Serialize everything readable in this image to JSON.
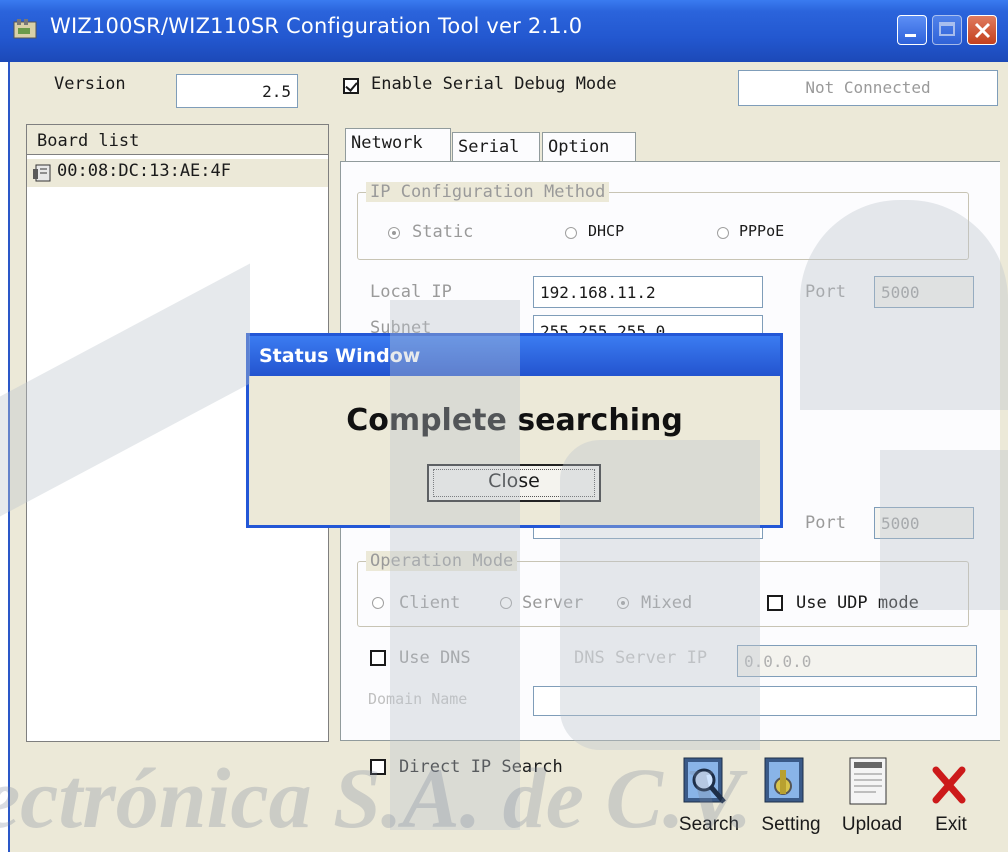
{
  "window": {
    "title": "WIZ100SR/WIZ110SR Configuration Tool ver 2.1.0"
  },
  "colors": {
    "titlebar": "#2358d0",
    "face": "#ece9d8",
    "status_border": "#2357d6"
  },
  "header": {
    "version_label": "Version",
    "version_value": "2.5",
    "debug_label": "Enable Serial Debug Mode",
    "debug_checked": true,
    "connection_status": "Not Connected"
  },
  "board_list": {
    "header": "Board list",
    "items": [
      {
        "label": "00:08:DC:13:AE:4F",
        "icon": "board-icon"
      }
    ]
  },
  "tabs": [
    {
      "label": "Network"
    },
    {
      "label": "Serial"
    },
    {
      "label": "Option"
    }
  ],
  "network": {
    "ip_method": {
      "title": "IP Configuration Method",
      "options": [
        {
          "label": "Static",
          "selected": true
        },
        {
          "label": "DHCP"
        },
        {
          "label": "PPPoE"
        }
      ]
    },
    "local_ip": {
      "label": "Local IP",
      "value": "192.168.11.2"
    },
    "port": {
      "label": "Port",
      "value": "5000"
    },
    "subnet": {
      "label": "Subnet",
      "value": "255.255.255.0"
    },
    "server_port": {
      "label": "Port",
      "value": "5000"
    },
    "operation_mode": {
      "title": "Operation Mode",
      "options": [
        {
          "label": "Client"
        },
        {
          "label": "Server"
        },
        {
          "label": "Mixed",
          "selected": true
        }
      ],
      "udp_label": "Use UDP mode"
    },
    "use_dns_label": "Use DNS",
    "dns_server_label": "DNS Server IP",
    "dns_server_value": "0.0.0.0",
    "domain_name_label": "Domain Name",
    "domain_name_value": ""
  },
  "direct_ip_search_label": "Direct IP Search",
  "toolbar": {
    "search": {
      "label": "Search",
      "icon": "search-icon"
    },
    "setting": {
      "label": "Setting",
      "icon": "setting-icon"
    },
    "upload": {
      "label": "Upload",
      "icon": "upload-icon"
    },
    "exit": {
      "label": "Exit",
      "icon": "exit-icon"
    }
  },
  "status_window": {
    "title": "Status Window",
    "message": "Complete searching",
    "close_label": "Close"
  },
  "watermark": {
    "text": "ectrónica S.A. de C.V."
  }
}
